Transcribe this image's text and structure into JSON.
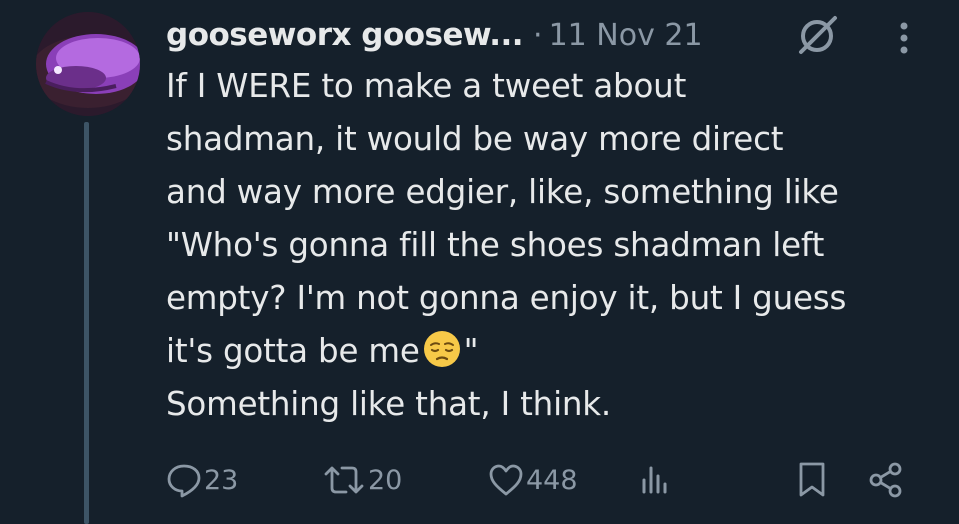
{
  "author": {
    "display_name": "gooseworx goosew...",
    "separator": "·",
    "timestamp": "11 Nov 21"
  },
  "tweet": {
    "lines": [
      "If I WERE to make a tweet about",
      "shadman, it would be way more direct",
      "and way more edgier, like, something like",
      "\"Who's gonna fill the shoes shadman left",
      "empty? I'm not gonna enjoy it, but I guess",
      "it's gotta be me"
    ],
    "line6_tail": "\"",
    "emoji": "pensive-face",
    "last_line": "Something like that, I think."
  },
  "actions": {
    "replies": "23",
    "retweets": "20",
    "likes": "448"
  },
  "icons": {
    "reply": "reply-icon",
    "retweet": "retweet-icon",
    "like": "heart-icon",
    "views": "views-icon",
    "bookmark": "bookmark-icon",
    "share": "share-icon",
    "grok": "grok-icon",
    "more": "more-icon"
  },
  "colors": {
    "background": "#15202b",
    "text": "#e7e9ea",
    "muted": "#8b98a5",
    "thread_line": "#3d5466"
  }
}
